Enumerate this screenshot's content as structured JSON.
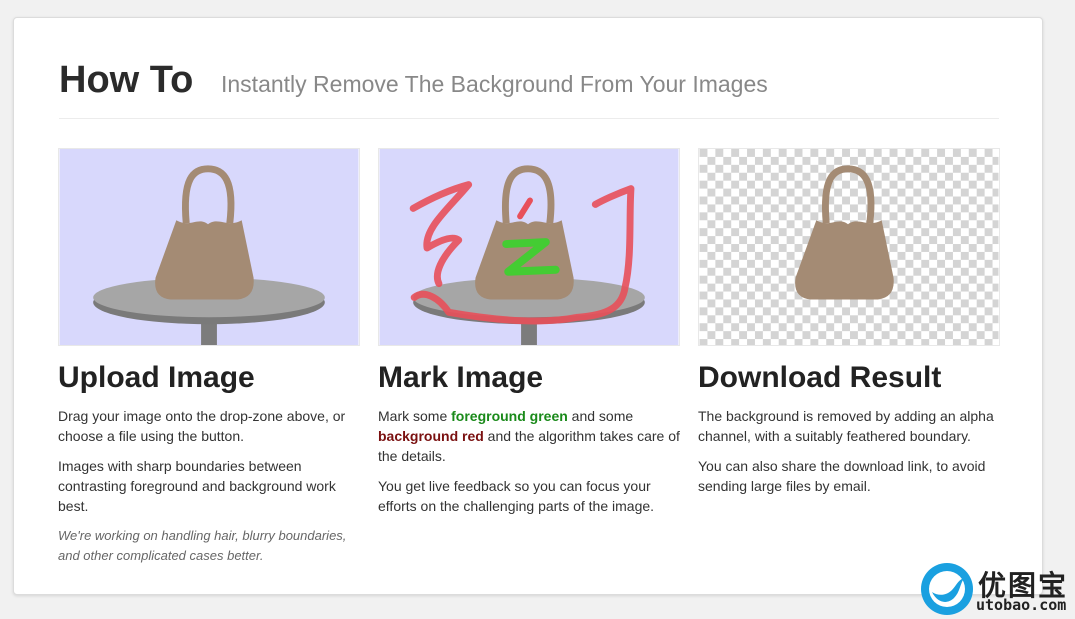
{
  "header": {
    "title": "How To",
    "subtitle": "Instantly Remove The Background From Your Images"
  },
  "steps": [
    {
      "heading": "Upload Image",
      "paragraphs": [
        "Drag your image onto the drop-zone above, or choose a file using the button.",
        "Images with sharp boundaries between contrasting foreground and background work best."
      ],
      "note": "We're working on handling hair, blurry boundaries, and other complicated cases better."
    },
    {
      "heading": "Mark Image",
      "p1_before": "Mark some ",
      "p1_fg": "foreground green",
      "p1_mid": " and some ",
      "p1_bg": "background red",
      "p1_after": " and the algorithm takes care of the details.",
      "p2": "You get live feedback so you can focus your efforts on the challenging parts of the image."
    },
    {
      "heading": "Download Result",
      "paragraphs": [
        "The background is removed by adding an alpha channel, with a suitably feathered boundary.",
        "You can also share the download link, to avoid sending large files by email."
      ]
    }
  ],
  "watermark": {
    "cn": "优图宝",
    "url": "utobao.com"
  },
  "colors": {
    "preview_bg": "#d8d8fc",
    "bag": "#a48b74",
    "table": "#a3a3a3",
    "mark_red": "#e8505a",
    "mark_green": "#44cc33",
    "foreground_text": "#1a8a1a",
    "background_text": "#7a1010",
    "logo_blue": "#1aa0e0"
  }
}
